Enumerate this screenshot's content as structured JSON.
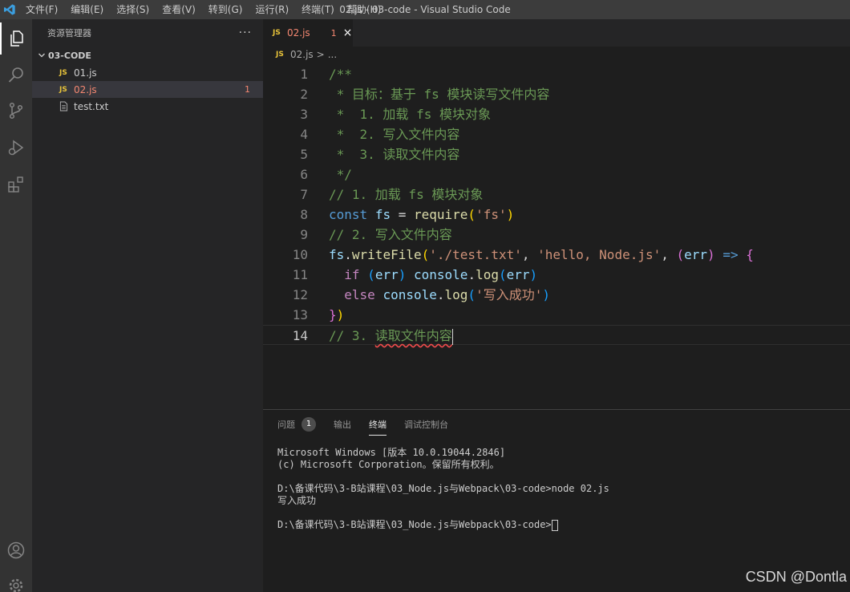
{
  "window": {
    "title": "02.js - 03-code - Visual Studio Code"
  },
  "menu": [
    "文件(F)",
    "编辑(E)",
    "选择(S)",
    "查看(V)",
    "转到(G)",
    "运行(R)",
    "终端(T)",
    "帮助(H)"
  ],
  "activity_icons": [
    "explorer-icon",
    "search-icon",
    "source-control-icon",
    "run-debug-icon",
    "extensions-icon",
    "account-icon",
    "settings-gear-icon"
  ],
  "explorer": {
    "title": "资源管理器",
    "more": "···",
    "folder": "03-CODE",
    "files": [
      {
        "badge": "JS",
        "name": "01.js",
        "errors": ""
      },
      {
        "badge": "JS",
        "name": "02.js",
        "errors": "1"
      },
      {
        "badge": "",
        "name": "test.txt",
        "errors": ""
      }
    ]
  },
  "tab": {
    "badge": "JS",
    "name": "02.js",
    "errors": "1",
    "close": "×"
  },
  "breadcrumb": {
    "badge": "JS",
    "file": "02.js",
    "sep": ">",
    "rest": "..."
  },
  "editor": {
    "line_numbers": [
      "1",
      "2",
      "3",
      "4",
      "5",
      "6",
      "7",
      "8",
      "9",
      "10",
      "11",
      "12",
      "13",
      "14"
    ],
    "lines": [
      "/**",
      " * 目标：基于 fs 模块读写文件内容",
      " *  1. 加载 fs 模块对象",
      " *  2. 写入文件内容",
      " *  3. 读取文件内容",
      " */",
      "// 1. 加载 fs 模块对象",
      "const fs = require('fs')",
      "// 2. 写入文件内容",
      "fs.writeFile('./test.txt', 'hello, Node.js', (err) => {",
      "  if (err) console.log(err)",
      "  else console.log('写入成功')",
      "})",
      "// 3. 读取文件内容"
    ],
    "t": {
      "const": "const",
      "fs": "fs",
      "eq": " = ",
      "require": "require",
      "lp": "(",
      "rp": ")",
      "fs_str": "'fs'",
      "dot": ".",
      "writeFile": "writeFile",
      "path_str": "'./test.txt'",
      "comma": ", ",
      "hello_str": "'hello, Node.js'",
      "err": "err",
      "arrow": " => ",
      "lb": "{",
      "rb": "}",
      "if": "if",
      "console": "console",
      "log": "log",
      "else": "else",
      "ok_str": "'写入成功'",
      "indent": "  ",
      "space": " ",
      "l14_a": "// 3. ",
      "l14_b": "读取文件内容"
    }
  },
  "panel": {
    "tabs": [
      "问题",
      "输出",
      "终端",
      "调试控制台"
    ],
    "problems_count": "1",
    "terminal_lines": [
      "Microsoft Windows [版本 10.0.19044.2846]",
      "(c) Microsoft Corporation。保留所有权利。",
      "",
      "D:\\备课代码\\3-B站课程\\03_Node.js与Webpack\\03-code>node 02.js",
      "写入成功",
      "",
      "D:\\备课代码\\3-B站课程\\03_Node.js与Webpack\\03-code>"
    ]
  },
  "watermark": "CSDN @Dontla",
  "colors": {
    "accent": "#007acc",
    "error": "#f48771",
    "js_badge": "#e8c33a",
    "comment": "#6a9955"
  }
}
